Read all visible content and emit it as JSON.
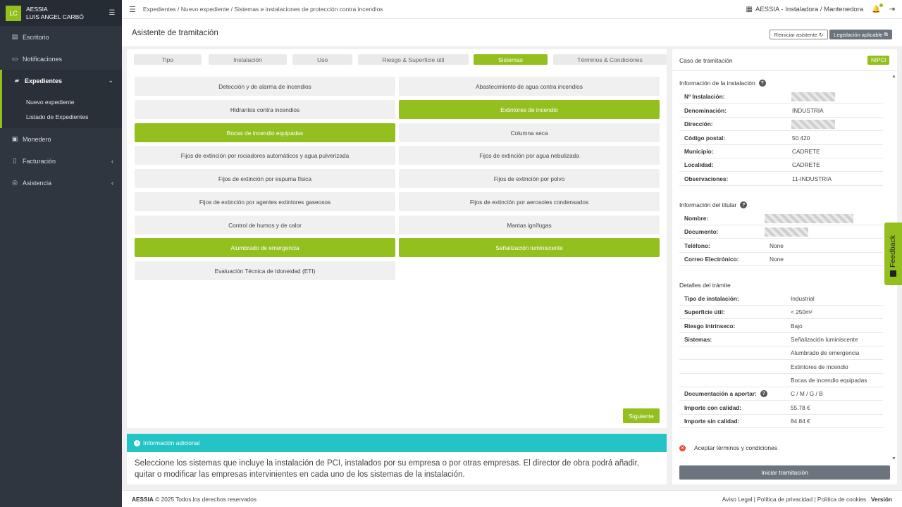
{
  "sidebar": {
    "avatar_initials": "LC",
    "brand_line1": "AESSIA",
    "brand_line2": "LUIS ANGEL CARBÓ",
    "items": [
      {
        "label": "Escritorio",
        "icon": "chart-icon"
      },
      {
        "label": "Notificaciones",
        "icon": "inbox-icon"
      },
      {
        "label": "Expedientes",
        "icon": "folder-icon"
      },
      {
        "label": "Monedero",
        "icon": "wallet-icon"
      },
      {
        "label": "Facturación",
        "icon": "file-icon"
      },
      {
        "label": "Asistencia",
        "icon": "lifebuoy-icon"
      }
    ],
    "subitems": [
      "Nuevo expediente",
      "Listado de Expedientes"
    ]
  },
  "topbar": {
    "breadcrumb": "Expedientes / Nuevo expediente / Sistemas e instalaciones de protección contra incendios",
    "company": "AESSIA - Instaladora / Mantenedora"
  },
  "header": {
    "title": "Asistente de tramitación",
    "reset_label": "Reiniciar asistente",
    "legislation_label": "Legislación aplicable"
  },
  "tabs": [
    "Tipo",
    "Instalación",
    "Uso",
    "Riesgo & Superficie útil",
    "Sistemas",
    "Términos & Condiciones"
  ],
  "systems": [
    {
      "label": "Detección y de alarma de incendios",
      "selected": false
    },
    {
      "label": "Abastecimiento de agua contra incendios",
      "selected": false
    },
    {
      "label": "Hidrantes contra incendios",
      "selected": false
    },
    {
      "label": "Extintores de incendio",
      "selected": true
    },
    {
      "label": "Bocas de incendio equipadas",
      "selected": true
    },
    {
      "label": "Columna seca",
      "selected": false
    },
    {
      "label": "Fijos de extinción por rociadores automáticos y agua pulverizada",
      "selected": false
    },
    {
      "label": "Fijos de extinción por agua nebulizada",
      "selected": false
    },
    {
      "label": "Fijos de extinción por espuma física",
      "selected": false
    },
    {
      "label": "Fijos de extinción por polvo",
      "selected": false
    },
    {
      "label": "Fijos de extinción por agentes extintores gaseosos",
      "selected": false
    },
    {
      "label": "Fijos de extinción por aerosoles condensados",
      "selected": false
    },
    {
      "label": "Control de humos y de calor",
      "selected": false
    },
    {
      "label": "Mantas ignífugas",
      "selected": false
    },
    {
      "label": "Alumbrado de emergencia",
      "selected": true
    },
    {
      "label": "Señalización luminiscente",
      "selected": true
    },
    {
      "label": "Evaluación Técnica de Idoneidad (ETI)",
      "selected": false
    }
  ],
  "next_label": "Siguiente",
  "info": {
    "title": "Información adicional",
    "text": "Seleccione los sistemas que incluye la instalación de PCI, instalados por su empresa o por otras empresas. El director de obra podrá añadir, quitar o modificar las empresas intervinientes en cada uno de los sistemas de la instalación."
  },
  "case": {
    "title": "Caso de tramitación",
    "badge": "NIPCI",
    "installation_title": "Información de la instalación",
    "installation": [
      {
        "label": "Nº Instalación:",
        "value": ""
      },
      {
        "label": "Denominación:",
        "value": "INDUSTRIA"
      },
      {
        "label": "Dirección:",
        "value": ""
      },
      {
        "label": "Código postal:",
        "value": "50 420"
      },
      {
        "label": "Municipio:",
        "value": "CADRETE"
      },
      {
        "label": "Localidad:",
        "value": "CADRETE"
      },
      {
        "label": "Observaciones:",
        "value": "11-INDUSTRIA"
      }
    ],
    "holder_title": "Información del titular",
    "holder": [
      {
        "label": "Nombre:",
        "value": ""
      },
      {
        "label": "Documento:",
        "value": ""
      },
      {
        "label": "Teléfono:",
        "value": "None"
      },
      {
        "label": "Correo Electrónico:",
        "value": "None"
      }
    ],
    "details_title": "Detalles del trámite",
    "details": [
      {
        "label": "Tipo de instalación:",
        "value": "Industrial"
      },
      {
        "label": "Superficie útil:",
        "value": "< 250m²"
      },
      {
        "label": "Riesgo intrínseco:",
        "value": "Bajo"
      },
      {
        "label": "Sistemas:",
        "value": "Señalización luminiscente"
      },
      {
        "label": "",
        "value": "Alumbrado de emergencia"
      },
      {
        "label": "",
        "value": "Extintores de incendio"
      },
      {
        "label": "",
        "value": "Bocas de incendio equipadas"
      },
      {
        "label": "Documentación a aportar:",
        "value": "C / M / G / B"
      },
      {
        "label": "Importe con calidad:",
        "value": "55.78 €"
      },
      {
        "label": "Importe sin calidad:",
        "value": "84.84 €"
      }
    ],
    "terms_label": "Aceptar términos y condiciones",
    "start_label": "Iniciar tramitación"
  },
  "feedback_label": "Feedback",
  "footer": {
    "brand": "AESSIA",
    "copyright": "© 2025 Todos los derechos reservados",
    "links": [
      "Aviso Legal",
      "Política de privacidad",
      "Política de cookies"
    ],
    "version": "Versión"
  },
  "colors": {
    "accent": "#93c01f",
    "sidebar": "#2f3640",
    "info": "#24c3c6",
    "gray_button": "#6c757d"
  }
}
